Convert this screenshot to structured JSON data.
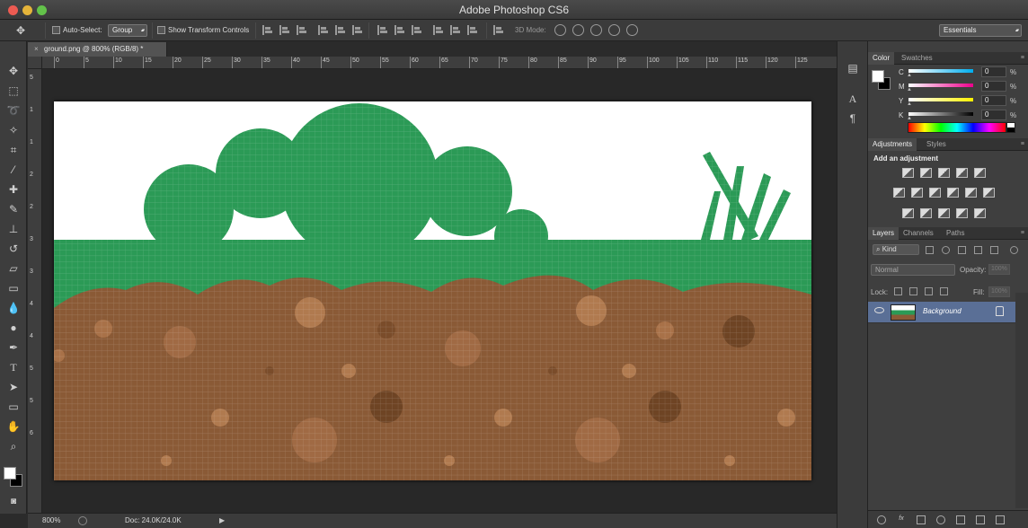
{
  "window": {
    "title": "Adobe Photoshop CS6"
  },
  "options_bar": {
    "auto_select_label": "Auto-Select:",
    "auto_select_value": "Group",
    "show_transform_label": "Show Transform Controls",
    "mode_3d_label": "3D Mode:",
    "workspace": "Essentials"
  },
  "document": {
    "tab_title": "ground.png @ 800% (RGB/8) *",
    "close_glyph": "×",
    "ruler_h_labels": [
      "0",
      "5",
      "10",
      "15",
      "20",
      "25",
      "30",
      "35",
      "40",
      "45",
      "50",
      "55",
      "60",
      "65",
      "70",
      "75",
      "80",
      "85",
      "90",
      "95",
      "100",
      "105",
      "110",
      "115",
      "120",
      "125"
    ],
    "ruler_v_labels": [
      "5",
      "1",
      "1",
      "2",
      "2",
      "3",
      "3",
      "4",
      "4",
      "5",
      "5",
      "6"
    ]
  },
  "status_bar": {
    "zoom": "800%",
    "doc_size": "Doc: 24.0K/24.0K",
    "arrow": "▶"
  },
  "color_panel": {
    "tabs": [
      "Color",
      "Swatches"
    ],
    "channels": [
      {
        "label": "C",
        "value": "0",
        "unit": "%",
        "gradient": "linear-gradient(90deg,#fff,#00aeef)"
      },
      {
        "label": "M",
        "value": "0",
        "unit": "%",
        "gradient": "linear-gradient(90deg,#fff,#ec008c)"
      },
      {
        "label": "Y",
        "value": "0",
        "unit": "%",
        "gradient": "linear-gradient(90deg,#fff,#fff200)"
      },
      {
        "label": "K",
        "value": "0",
        "unit": "%",
        "gradient": "linear-gradient(90deg,#fff,#000)"
      }
    ]
  },
  "adjustments_panel": {
    "tabs": [
      "Adjustments",
      "Styles"
    ],
    "heading": "Add an adjustment"
  },
  "layers_panel": {
    "tabs": [
      "Layers",
      "Channels",
      "Paths"
    ],
    "filter_kind": "Kind",
    "blend_mode": "Normal",
    "opacity_label": "Opacity:",
    "opacity_value": "100%",
    "lock_label": "Lock:",
    "fill_label": "Fill:",
    "fill_value": "100%",
    "layers": [
      {
        "name": "Background",
        "locked": true,
        "visible": true
      }
    ]
  },
  "colors": {
    "grass": "#2b9a56",
    "dirt": "#8a5a36",
    "sky": "#ffffff",
    "layer_selected": "#5a6f96"
  }
}
